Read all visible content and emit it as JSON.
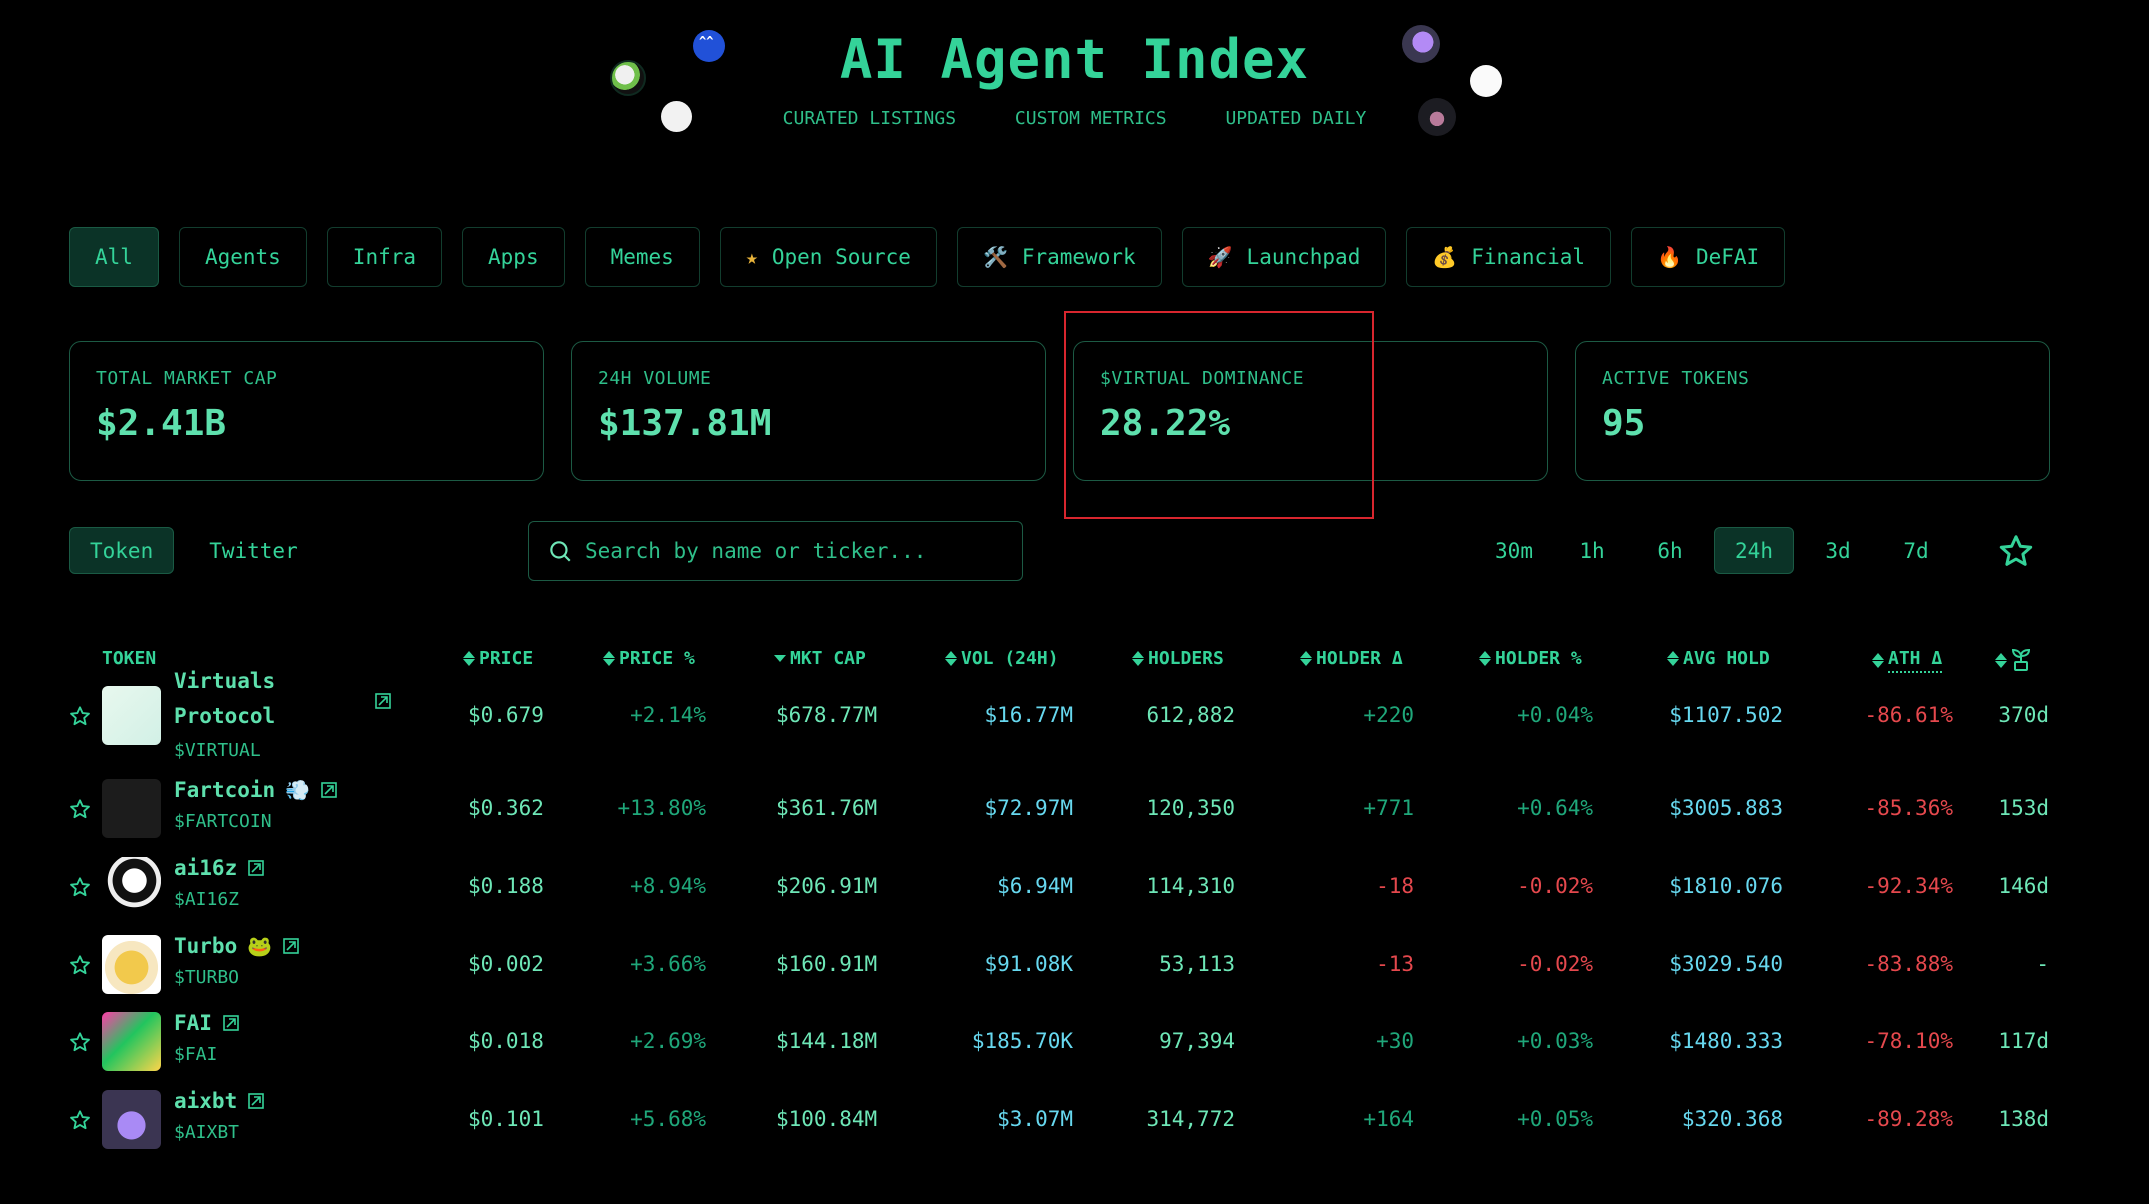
{
  "header": {
    "title": "AI Agent Index",
    "taglines": [
      "CURATED LISTINGS",
      "CUSTOM METRICS",
      "UPDATED DAILY"
    ]
  },
  "categories": [
    {
      "label": "All",
      "icon": "",
      "active": true
    },
    {
      "label": "Agents",
      "icon": ""
    },
    {
      "label": "Infra",
      "icon": ""
    },
    {
      "label": "Apps",
      "icon": ""
    },
    {
      "label": "Memes",
      "icon": ""
    },
    {
      "label": "Open Source",
      "icon": "★"
    },
    {
      "label": "Framework",
      "icon": "🛠️"
    },
    {
      "label": "Launchpad",
      "icon": "🚀"
    },
    {
      "label": "Financial",
      "icon": "💰"
    },
    {
      "label": "DeFAI",
      "icon": "🔥"
    }
  ],
  "stats": [
    {
      "label": "TOTAL MARKET CAP",
      "value": "$2.41B"
    },
    {
      "label": "24H VOLUME",
      "value": "$137.81M"
    },
    {
      "label": "$VIRTUAL DOMINANCE",
      "value": "28.22%"
    },
    {
      "label": "ACTIVE TOKENS",
      "value": "95"
    }
  ],
  "view_tabs": [
    {
      "label": "Token",
      "active": true
    },
    {
      "label": "Twitter"
    }
  ],
  "search": {
    "placeholder": "Search by name or ticker...",
    "value": ""
  },
  "timeframes": [
    {
      "label": "30m"
    },
    {
      "label": "1h"
    },
    {
      "label": "6h"
    },
    {
      "label": "24h",
      "active": true
    },
    {
      "label": "3d"
    },
    {
      "label": "7d"
    }
  ],
  "table": {
    "columns": {
      "token": "TOKEN",
      "price": "PRICE",
      "price_pct": "PRICE %",
      "mkt_cap": "MKT CAP",
      "vol": "VOL (24H)",
      "holders": "HOLDERS",
      "holder_delta": "HOLDER Δ",
      "holder_pct": "HOLDER %",
      "avg_hold": "AVG HOLD",
      "ath_delta": "ATH Δ",
      "age_icon": "sprout-icon"
    },
    "sorted_column": "mkt_cap",
    "sort_direction": "desc",
    "rows": [
      {
        "name": "Virtuals Protocol",
        "name_line1": "Virtuals",
        "name_line2": "Protocol",
        "ticker": "$VIRTUAL",
        "emoji": "",
        "price": "$0.679",
        "price_pct": "+2.14%",
        "mkt_cap": "$678.77M",
        "vol": "$16.77M",
        "holders": "612,882",
        "holder_delta": "+220",
        "holder_pct": "+0.04%",
        "avg_hold": "$1107.502",
        "ath_delta": "-86.61%",
        "age": "370d"
      },
      {
        "name": "Fartcoin",
        "ticker": "$FARTCOIN",
        "emoji": "💨",
        "price": "$0.362",
        "price_pct": "+13.80%",
        "mkt_cap": "$361.76M",
        "vol": "$72.97M",
        "holders": "120,350",
        "holder_delta": "+771",
        "holder_pct": "+0.64%",
        "avg_hold": "$3005.883",
        "ath_delta": "-85.36%",
        "age": "153d"
      },
      {
        "name": "ai16z",
        "ticker": "$AI16Z",
        "emoji": "",
        "price": "$0.188",
        "price_pct": "+8.94%",
        "mkt_cap": "$206.91M",
        "vol": "$6.94M",
        "holders": "114,310",
        "holder_delta": "-18",
        "holder_pct": "-0.02%",
        "avg_hold": "$1810.076",
        "ath_delta": "-92.34%",
        "age": "146d"
      },
      {
        "name": "Turbo",
        "ticker": "$TURBO",
        "emoji": "🐸",
        "price": "$0.002",
        "price_pct": "+3.66%",
        "mkt_cap": "$160.91M",
        "vol": "$91.08K",
        "holders": "53,113",
        "holder_delta": "-13",
        "holder_pct": "-0.02%",
        "avg_hold": "$3029.540",
        "ath_delta": "-83.88%",
        "age": "-"
      },
      {
        "name": "FAI",
        "ticker": "$FAI",
        "emoji": "",
        "price": "$0.018",
        "price_pct": "+2.69%",
        "mkt_cap": "$144.18M",
        "vol": "$185.70K",
        "holders": "97,394",
        "holder_delta": "+30",
        "holder_pct": "+0.03%",
        "avg_hold": "$1480.333",
        "ath_delta": "-78.10%",
        "age": "117d"
      },
      {
        "name": "aixbt",
        "ticker": "$AIXBT",
        "emoji": "",
        "price": "$0.101",
        "price_pct": "+5.68%",
        "mkt_cap": "$100.84M",
        "vol": "$3.07M",
        "holders": "314,772",
        "holder_delta": "+164",
        "holder_pct": "+0.05%",
        "avg_hold": "$320.368",
        "ath_delta": "-89.28%",
        "age": "138d"
      }
    ]
  },
  "colors": {
    "accent": "#34d399",
    "positive": "#1fa77a",
    "negative": "#e5484d",
    "volume": "#67d8ef",
    "highlight_box": "#d8262e"
  }
}
